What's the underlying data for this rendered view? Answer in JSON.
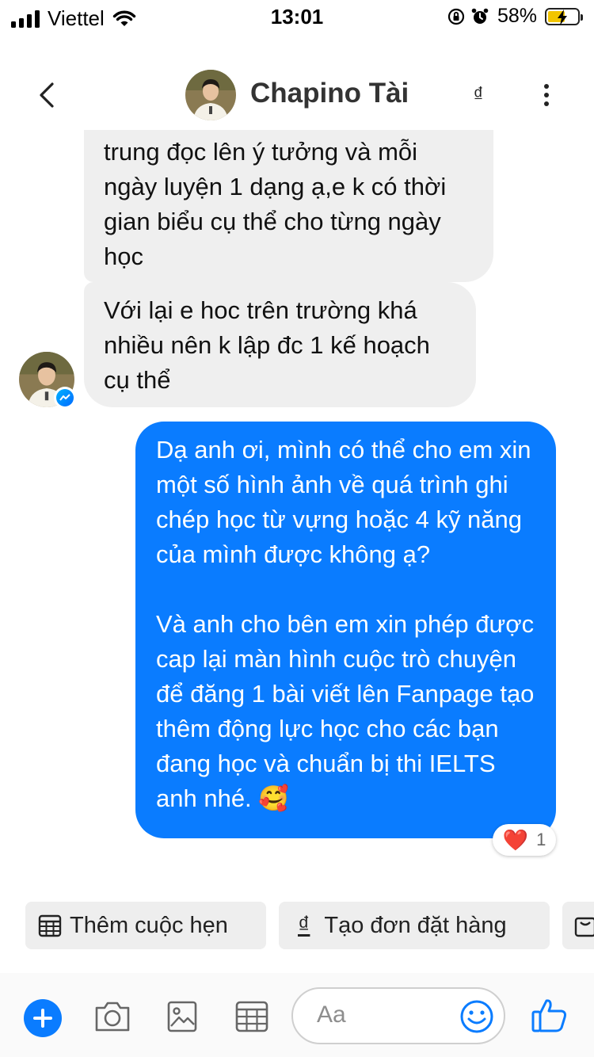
{
  "status_bar": {
    "carrier": "Viettel",
    "time": "13:01",
    "battery_percent": "58%",
    "battery_level": 0.58,
    "icons": [
      "signal-bars-icon",
      "wifi-icon",
      "orientation-lock-icon",
      "alarm-icon",
      "battery-charging-icon"
    ]
  },
  "header": {
    "contact_name": "Chapino Tài",
    "currency_symbol": "₫",
    "icons": [
      "back-chevron-icon",
      "avatar",
      "more-vertical-icon"
    ]
  },
  "messages": {
    "incoming_1": "trung đọc lên ý tưởng và mỗi ngày luyện 1 dạng ạ,e k có thời gian biểu cụ thể cho từng ngày học",
    "incoming_2": "Với lại e hoc trên trường khá nhiều nên k lập đc 1 kế hoạch cụ thể",
    "outgoing_1": "Dạ anh ơi, mình có thể cho em xin một số hình ảnh về quá trình ghi chép học từ vựng hoặc 4 kỹ năng của mình được không ạ?\n\nVà anh cho bên em xin phép được cap lại màn hình cuộc trò chuyện để đăng 1 bài viết lên Fanpage tạo thêm động lực học cho các bạn đang học và chuẩn bị thi IELTS anh nhé. 🥰",
    "reaction_emoji": "❤️",
    "reaction_count": "1"
  },
  "quick_actions": {
    "appointment_label": "Thêm cuộc hẹn",
    "order_icon": "₫",
    "order_label": "Tạo đơn đặt hàng"
  },
  "composer": {
    "placeholder": "Aa",
    "icons": [
      "plus-icon",
      "camera-icon",
      "gallery-icon",
      "calendar-icon",
      "emoji-icon",
      "thumbs-up-icon"
    ]
  },
  "colors": {
    "accent": "#0a7cff",
    "incoming_bubble": "#efefef",
    "chip_bg": "#eeeeee",
    "battery_fill": "#f2c500"
  }
}
